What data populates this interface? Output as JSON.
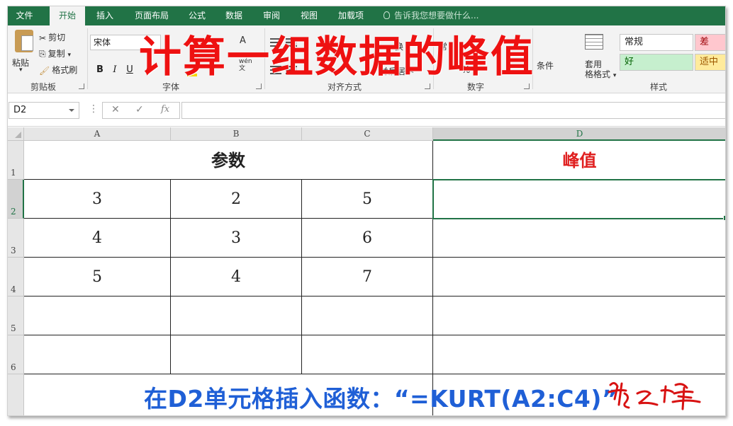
{
  "ribbon": {
    "tabs": [
      "文件",
      "开始",
      "插入",
      "页面布局",
      "公式",
      "数据",
      "审阅",
      "视图",
      "加载项"
    ],
    "active_tab": "开始",
    "tell_me": "告诉我您想要做什么...",
    "clipboard": {
      "paste": "粘贴",
      "cut": "剪切",
      "copy": "复制",
      "format_painter": "格式刷",
      "group": "剪贴板"
    },
    "font": {
      "name": "宋体",
      "bold": "B",
      "italic": "I",
      "underline": "U",
      "wen": "wén",
      "group": "字体"
    },
    "alignment": {
      "wrap_partial": "换",
      "merge_partial": "并后居中",
      "group": "对齐方式"
    },
    "number": {
      "format_partial": "常",
      "percent": "%",
      "group": "数字"
    },
    "styles": {
      "conditional_partial": "条件",
      "table_format_1": "套用",
      "table_format_2": "格格式",
      "normal": "常规",
      "bad": "差",
      "good": "好",
      "neutral": "适中",
      "group": "样式"
    }
  },
  "overlay_title": "计算一组数据的峰值",
  "formula_bar": {
    "name_box": "D2",
    "dots": "⋮",
    "cancel": "✕",
    "enter": "✓",
    "fx": "fx",
    "content": ""
  },
  "sheet": {
    "columns": [
      "A",
      "B",
      "C",
      "D"
    ],
    "rows": [
      "1",
      "2",
      "3",
      "4",
      "5",
      "6"
    ],
    "header_params": "参数",
    "header_peak": "峰值",
    "data": [
      [
        "3",
        "2",
        "5",
        ""
      ],
      [
        "4",
        "3",
        "6",
        ""
      ],
      [
        "5",
        "4",
        "7",
        ""
      ],
      [
        "",
        "",
        "",
        ""
      ],
      [
        "",
        "",
        "",
        ""
      ]
    ],
    "selected_cell": "D2"
  },
  "bottom_note": "在D2单元格插入函数：“=KURT(A2:C4)”",
  "colors": {
    "excel_green": "#217346",
    "title_red": "#ee1111",
    "note_blue": "#1f5fd6",
    "peak_red": "#e02020"
  }
}
